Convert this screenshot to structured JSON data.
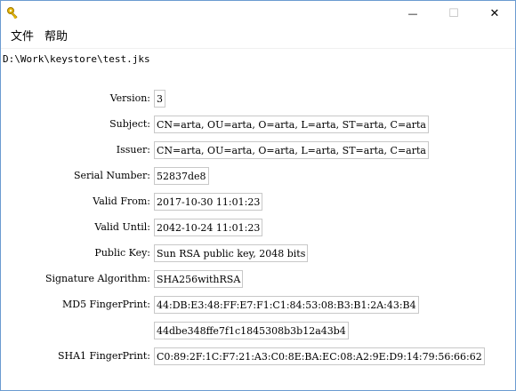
{
  "window": {
    "app_icon": "key-icon",
    "minimize_glyph": "—",
    "maximize_glyph": "☐",
    "close_glyph": "✕"
  },
  "menu": {
    "file": "文件",
    "help": "帮助"
  },
  "path": "D:\\Work\\keystore\\test.jks",
  "fields": {
    "version": {
      "label": "Version:",
      "value": "3"
    },
    "subject": {
      "label": "Subject:",
      "value": "CN=arta, OU=arta, O=arta, L=arta, ST=arta, C=arta"
    },
    "issuer": {
      "label": "Issuer:",
      "value": "CN=arta, OU=arta, O=arta, L=arta, ST=arta, C=arta"
    },
    "serial": {
      "label": "Serial Number:",
      "value": "52837de8"
    },
    "valid_from": {
      "label": "Valid From:",
      "value": "2017-10-30 11:01:23"
    },
    "valid_until": {
      "label": "Valid Until:",
      "value": "2042-10-24 11:01:23"
    },
    "public_key": {
      "label": "Public Key:",
      "value": "Sun RSA public key, 2048 bits"
    },
    "sig_alg": {
      "label": "Signature Algorithm:",
      "value": "SHA256withRSA"
    },
    "md5": {
      "label": "MD5 FingerPrint:",
      "value": "44:DB:E3:48:FF:E7:F1:C1:84:53:08:B3:B1:2A:43:B4"
    },
    "md5_hex": {
      "value": "44dbe348ffe7f1c1845308b3b12a43b4"
    },
    "sha1": {
      "label": "SHA1 FingerPrint:",
      "value": "C0:89:2F:1C:F7:21:A3:C0:8E:BA:EC:08:A2:9E:D9:14:79:56:66:62"
    }
  },
  "colors": {
    "window_border": "#6b9bd1",
    "field_border": "#c8c8c8",
    "icon_gold": "#e6b800"
  }
}
